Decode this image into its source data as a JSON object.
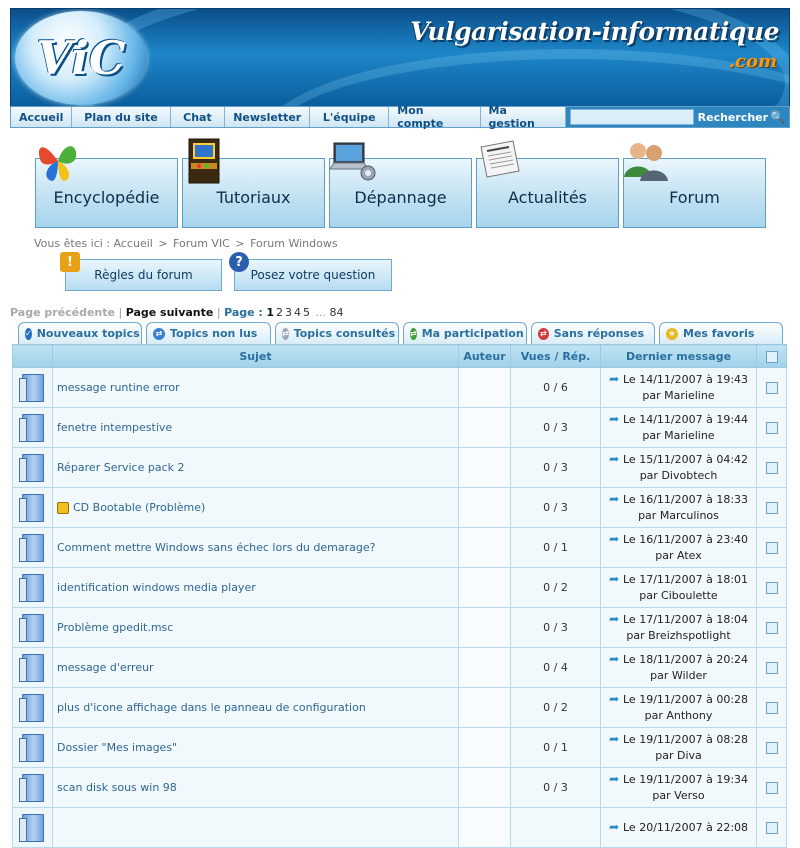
{
  "header": {
    "logo_text": "ViC",
    "site_title": "Vulgarisation-informatique",
    "site_tld": ".com"
  },
  "nav": {
    "items": [
      {
        "label": "Accueil"
      },
      {
        "label": "Plan du site"
      },
      {
        "label": "Chat"
      },
      {
        "label": "Newsletter"
      },
      {
        "label": "L'équipe"
      },
      {
        "label": "Mon compte"
      },
      {
        "label": "Ma gestion"
      }
    ],
    "search_value": "",
    "search_button": "Rechercher"
  },
  "categories": [
    {
      "label": "Encyclopédie",
      "icon": "butterfly-icon"
    },
    {
      "label": "Tutoriaux",
      "icon": "arcade-icon"
    },
    {
      "label": "Dépannage",
      "icon": "laptop-gear-icon"
    },
    {
      "label": "Actualités",
      "icon": "newspaper-icon"
    },
    {
      "label": "Forum",
      "icon": "users-icon"
    }
  ],
  "breadcrumb": {
    "prefix": "Vous êtes ici :",
    "items": [
      "Accueil",
      "Forum VIC",
      "Forum Windows"
    ],
    "separator": ">"
  },
  "forum_buttons": {
    "rules": "Règles du forum",
    "ask": "Posez votre question"
  },
  "pagination": {
    "prev": "Page précédente",
    "divider": "|",
    "next": "Page suivante",
    "page_label": "Page :",
    "pages": [
      "1",
      "2",
      "3",
      "4",
      "5"
    ],
    "ellipsis": "...",
    "last": "84",
    "current": "1"
  },
  "tabs": [
    {
      "label": "Nouveaux topics",
      "color": "#2b6fc0"
    },
    {
      "label": "Topics non lus",
      "color": "#3a7fd0"
    },
    {
      "label": "Topics consultés",
      "color": "#9aa7b8"
    },
    {
      "label": "Ma participation",
      "color": "#3da03d"
    },
    {
      "label": "Sans réponses",
      "color": "#d23b3b"
    },
    {
      "label": "Mes favoris",
      "color": "#e8b820"
    }
  ],
  "table": {
    "headers": {
      "subject": "Sujet",
      "author": "Auteur",
      "views": "Vues / Rép.",
      "last": "Dernier message"
    },
    "rows": [
      {
        "subject": "message runtine error",
        "author": "",
        "views": "0 / 6",
        "last_date": "Le 14/11/2007 à 19:43",
        "last_by": "par Marieline",
        "locked": false
      },
      {
        "subject": "fenetre intempestive",
        "author": "",
        "views": "0 / 3",
        "last_date": "Le 14/11/2007 à 19:44",
        "last_by": "par Marieline",
        "locked": false
      },
      {
        "subject": "Réparer Service pack 2",
        "author": "",
        "views": "0 / 3",
        "last_date": "Le 15/11/2007 à 04:42",
        "last_by": "par Divobtech",
        "locked": false
      },
      {
        "subject": "CD Bootable (Problème)",
        "author": "",
        "views": "0 / 3",
        "last_date": "Le 16/11/2007 à 18:33",
        "last_by": "par Marculinos",
        "locked": true
      },
      {
        "subject": "Comment mettre Windows sans échec lors du demarage?",
        "author": "",
        "views": "0 / 1",
        "last_date": "Le 16/11/2007 à 23:40",
        "last_by": "par Atex",
        "locked": false
      },
      {
        "subject": "identification windows media player",
        "author": "",
        "views": "0 / 2",
        "last_date": "Le 17/11/2007 à 18:01",
        "last_by": "par Ciboulette",
        "locked": false
      },
      {
        "subject": "Problème gpedit.msc",
        "author": "",
        "views": "0 / 3",
        "last_date": "Le 17/11/2007 à 18:04",
        "last_by": "par Breizhspotlight",
        "locked": false
      },
      {
        "subject": "message d'erreur",
        "author": "",
        "views": "0 / 4",
        "last_date": "Le 18/11/2007 à 20:24",
        "last_by": "par Wilder",
        "locked": false
      },
      {
        "subject": "plus d'icone affichage dans le panneau de configuration",
        "author": "",
        "views": "0 / 2",
        "last_date": "Le 19/11/2007 à 00:28",
        "last_by": "par Anthony",
        "locked": false
      },
      {
        "subject": "Dossier \"Mes images\"",
        "author": "",
        "views": "0 / 1",
        "last_date": "Le 19/11/2007 à 08:28",
        "last_by": "par Diva",
        "locked": false
      },
      {
        "subject": "scan disk sous win 98",
        "author": "",
        "views": "0 / 3",
        "last_date": "Le 19/11/2007 à 19:34",
        "last_by": "par Verso",
        "locked": false
      },
      {
        "subject": "",
        "author": "",
        "views": "",
        "last_date": "Le 20/11/2007 à 22:08",
        "last_by": "",
        "locked": false
      }
    ]
  }
}
